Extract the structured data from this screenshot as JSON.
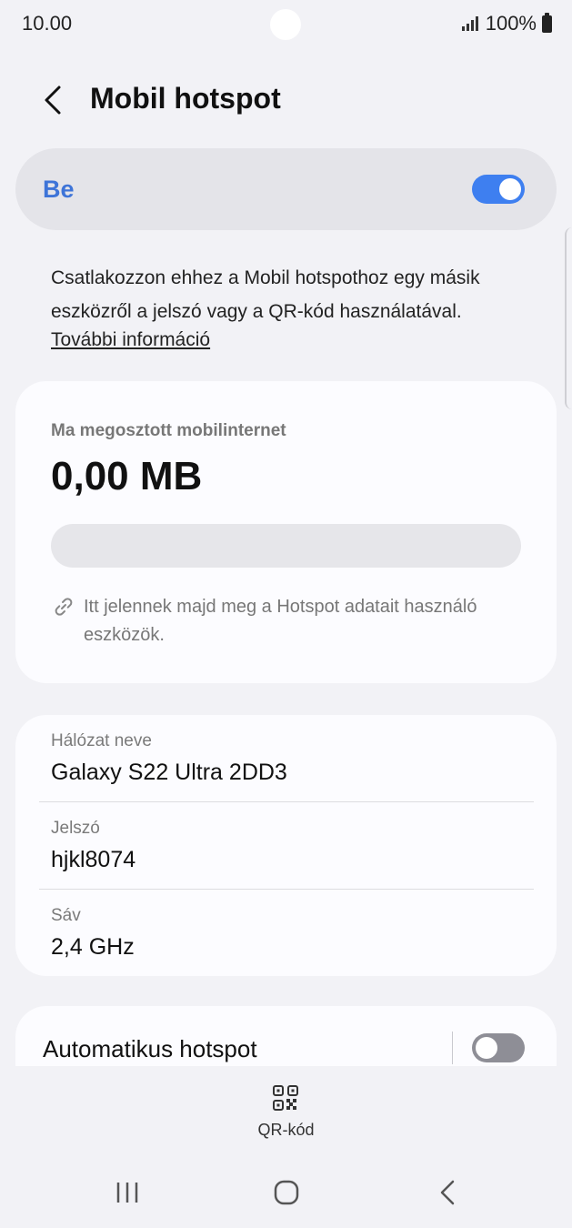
{
  "status_bar": {
    "time": "10.00",
    "battery": "100%",
    "icons": [
      "signal-icon",
      "battery-icon"
    ]
  },
  "header": {
    "title": "Mobil hotspot",
    "back_icon": "chevron-left-icon"
  },
  "master_switch": {
    "label": "Be",
    "on": true,
    "accent_color": "#3e7ff0"
  },
  "description": {
    "text": "Csatlakozzon ehhez a Mobil hotspothoz egy másik eszközről a jelszó vagy a QR-kód használatával.",
    "link": "További információ"
  },
  "usage": {
    "label": "Ma megosztott mobilinternet",
    "value": "0,00 MB",
    "bar_fraction": 0,
    "devices_note": "Itt jelennek majd meg a Hotspot adatait használó eszközök.",
    "icon": "link-icon"
  },
  "network": {
    "name_label": "Hálózat neve",
    "name_value": "Galaxy S22 Ultra 2DD3",
    "password_label": "Jelszó",
    "password_value": "hjkl8074",
    "band_label": "Sáv",
    "band_value": "2,4 GHz"
  },
  "auto_hotspot": {
    "label": "Automatikus hotspot",
    "on": false
  },
  "bottom_action": {
    "label": "QR-kód",
    "icon": "qr-code-icon"
  },
  "nav_bar": {
    "icons": [
      "recent-apps-icon",
      "home-icon",
      "back-icon"
    ]
  }
}
